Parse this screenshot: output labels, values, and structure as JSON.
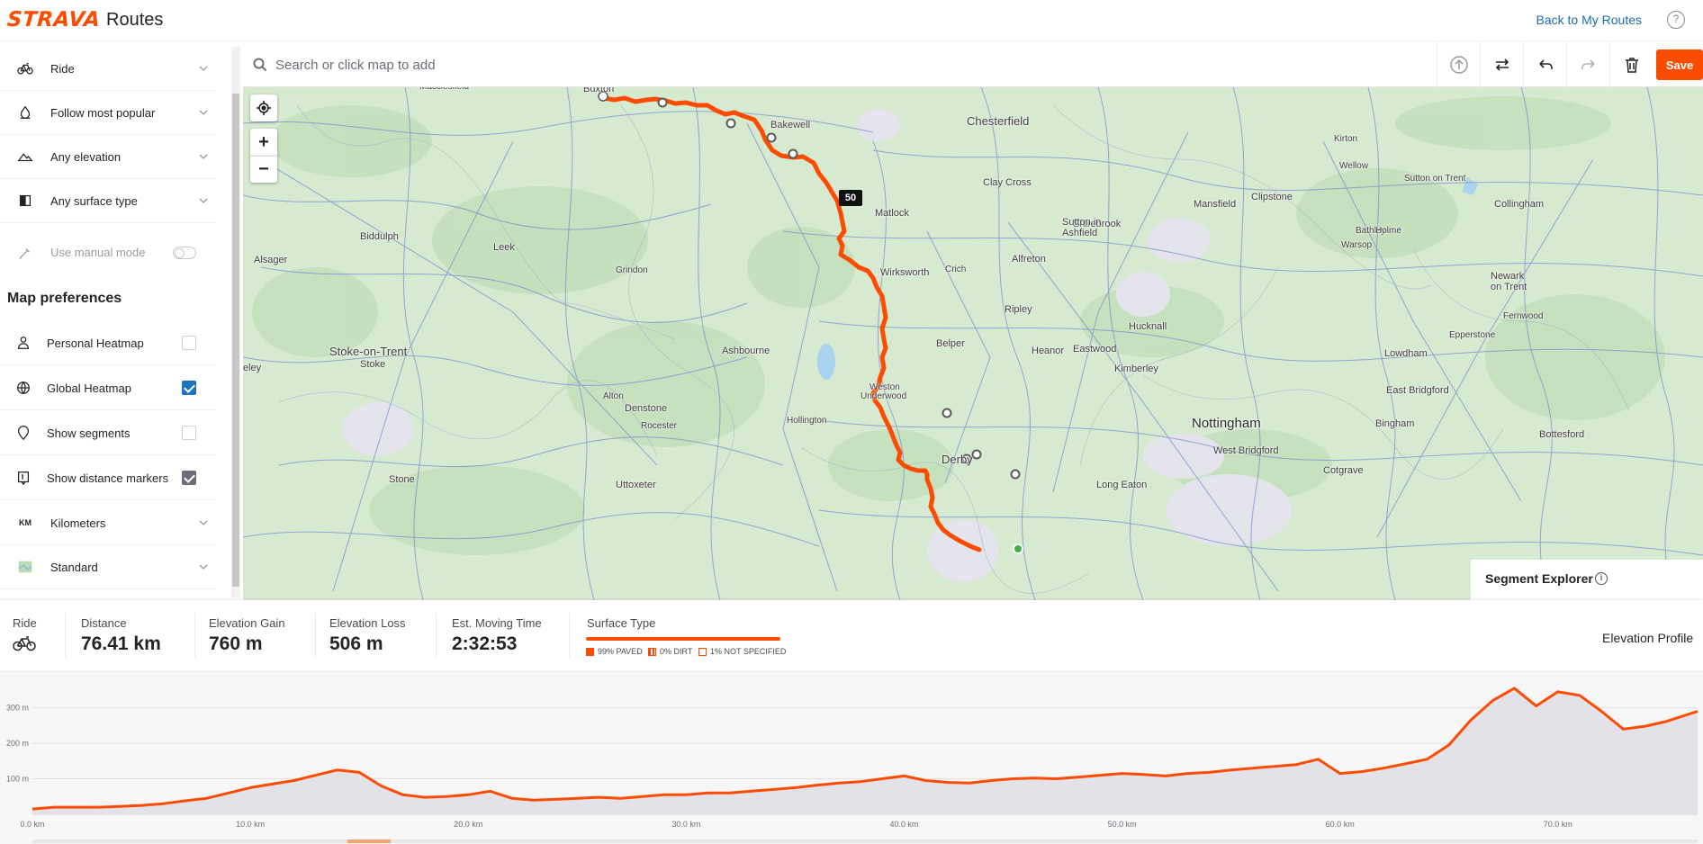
{
  "header": {
    "logo": "STRAVA",
    "title": "Routes",
    "back_link": "Back to My Routes",
    "help": "?"
  },
  "sidebar": {
    "options": [
      {
        "label": "Ride",
        "icon": "bike-icon"
      },
      {
        "label": "Follow most popular",
        "icon": "popularity-icon"
      },
      {
        "label": "Any elevation",
        "icon": "elevation-icon"
      },
      {
        "label": "Any surface type",
        "icon": "surface-icon"
      }
    ],
    "manual_mode": {
      "label": "Use manual mode",
      "enabled": false
    },
    "map_preferences_title": "Map preferences",
    "preferences": [
      {
        "label": "Personal Heatmap",
        "icon": "person-icon",
        "checked": false
      },
      {
        "label": "Global Heatmap",
        "icon": "globe-icon",
        "checked": true
      },
      {
        "label": "Show segments",
        "icon": "segment-icon",
        "checked": false
      },
      {
        "label": "Show distance markers",
        "icon": "distance-marker-icon",
        "checked": true
      }
    ],
    "units": {
      "label": "Kilometers",
      "badge": "KM"
    },
    "map_style": {
      "label": "Standard"
    }
  },
  "search": {
    "placeholder": "Search or click map to add"
  },
  "toolbar": {
    "save_label": "Save"
  },
  "map": {
    "distance_marker": "50",
    "zoom_in": "+",
    "zoom_out": "−",
    "segment_explorer": "Segment Explorer",
    "segment_info": "i",
    "towns": [
      {
        "name": "Chesterfield",
        "cls": "med"
      },
      {
        "name": "Macclesfield",
        "cls": "small"
      },
      {
        "name": "Buxton",
        "cls": ""
      },
      {
        "name": "Bakewell",
        "cls": ""
      },
      {
        "name": "Shirebrook",
        "cls": ""
      },
      {
        "name": "Kirton",
        "cls": "small"
      },
      {
        "name": "Clipstone",
        "cls": ""
      },
      {
        "name": "Sutton on Trent",
        "cls": "small"
      },
      {
        "name": "Collingham",
        "cls": ""
      },
      {
        "name": "Warsop",
        "cls": "small"
      },
      {
        "name": "Wellow",
        "cls": "small"
      },
      {
        "name": "Clay Cross",
        "cls": ""
      },
      {
        "name": "Mansfield",
        "cls": ""
      },
      {
        "name": "Matlock",
        "cls": ""
      },
      {
        "name": "Sutton in",
        "cls": ""
      },
      {
        "name": "Ashfield",
        "cls": ""
      },
      {
        "name": "Bathley",
        "cls": "small"
      },
      {
        "name": "Holme",
        "cls": "small"
      },
      {
        "name": "Biddulph",
        "cls": ""
      },
      {
        "name": "Leek",
        "cls": ""
      },
      {
        "name": "Alfreton",
        "cls": ""
      },
      {
        "name": "Alsager",
        "cls": ""
      },
      {
        "name": "Crich",
        "cls": "small"
      },
      {
        "name": "Grindon",
        "cls": "small"
      },
      {
        "name": "Wirksworth",
        "cls": ""
      },
      {
        "name": "Newark",
        "cls": ""
      },
      {
        "name": "on Trent",
        "cls": ""
      },
      {
        "name": "Ripley",
        "cls": ""
      },
      {
        "name": "Fernwood",
        "cls": "small"
      },
      {
        "name": "Hucknall",
        "cls": ""
      },
      {
        "name": "Epperstone",
        "cls": "small"
      },
      {
        "name": "Belper",
        "cls": ""
      },
      {
        "name": "Stoke-on-Trent",
        "cls": "med"
      },
      {
        "name": "Ashbourne",
        "cls": ""
      },
      {
        "name": "Heanor",
        "cls": ""
      },
      {
        "name": "Eastwood",
        "cls": ""
      },
      {
        "name": "Lowdham",
        "cls": ""
      },
      {
        "name": "Stoke",
        "cls": ""
      },
      {
        "name": "Kimberley",
        "cls": ""
      },
      {
        "name": "eley",
        "cls": ""
      },
      {
        "name": "Weston",
        "cls": "small"
      },
      {
        "name": "Underwood",
        "cls": "small"
      },
      {
        "name": "East Bridgford",
        "cls": ""
      },
      {
        "name": "Alton",
        "cls": "small"
      },
      {
        "name": "Denstone",
        "cls": ""
      },
      {
        "name": "Nottingham",
        "cls": "big"
      },
      {
        "name": "Bingham",
        "cls": ""
      },
      {
        "name": "Hollington",
        "cls": "small"
      },
      {
        "name": "Rocester",
        "cls": "small"
      },
      {
        "name": "West Bridgford",
        "cls": ""
      },
      {
        "name": "Bottesford",
        "cls": ""
      },
      {
        "name": "Derby",
        "cls": "med"
      },
      {
        "name": "Cotgrave",
        "cls": ""
      },
      {
        "name": "Stone",
        "cls": ""
      },
      {
        "name": "Uttoxeter",
        "cls": ""
      },
      {
        "name": "Long Eaton",
        "cls": ""
      }
    ]
  },
  "stats": {
    "activity_label": "Ride",
    "distance": {
      "label": "Distance",
      "value": "76.41 km"
    },
    "elevation_gain": {
      "label": "Elevation Gain",
      "value": "760 m"
    },
    "elevation_loss": {
      "label": "Elevation Loss",
      "value": "506 m"
    },
    "moving_time": {
      "label": "Est. Moving Time",
      "value": "2:32:53"
    },
    "surface": {
      "label": "Surface Type",
      "legend": [
        "99% PAVED",
        "0% DIRT",
        "1% NOT SPECIFIED"
      ]
    },
    "elevation_profile_label": "Elevation Profile"
  },
  "colors": {
    "accent": "#fc4c02",
    "link": "#1c6ca8",
    "check": "#1c74c0"
  },
  "chart_data": {
    "type": "area",
    "x_unit": "km",
    "y_unit": "m",
    "xlim": [
      0,
      76.41
    ],
    "ylim": [
      0,
      380
    ],
    "y_ticks": [
      "100 m",
      "200 m",
      "300 m"
    ],
    "y_tick_values": [
      100,
      200,
      300
    ],
    "x_ticks": [
      "0.0 km",
      "10.0 km",
      "20.0 km",
      "30.0 km",
      "40.0 km",
      "50.0 km",
      "60.0 km",
      "70.0 km"
    ],
    "x_tick_values": [
      0,
      10,
      20,
      30,
      40,
      50,
      60,
      70
    ],
    "x": [
      0,
      1,
      2,
      3,
      4,
      5,
      6,
      7,
      8,
      9,
      10,
      11,
      12,
      13,
      14,
      15,
      16,
      17,
      18,
      19,
      20,
      21,
      22,
      23,
      24,
      25,
      26,
      27,
      28,
      29,
      30,
      31,
      32,
      33,
      34,
      35,
      36,
      37,
      38,
      39,
      40,
      41,
      42,
      43,
      44,
      45,
      46,
      47,
      48,
      49,
      50,
      51,
      52,
      53,
      54,
      55,
      56,
      57,
      58,
      59,
      60,
      61,
      62,
      63,
      64,
      65,
      66,
      67,
      68,
      69,
      70,
      71,
      72,
      73,
      74,
      75,
      76.41
    ],
    "values": [
      15,
      20,
      20,
      20,
      22,
      25,
      30,
      38,
      45,
      60,
      75,
      85,
      95,
      110,
      125,
      118,
      80,
      55,
      48,
      50,
      55,
      65,
      45,
      40,
      42,
      45,
      48,
      45,
      50,
      55,
      55,
      60,
      60,
      65,
      70,
      75,
      82,
      88,
      92,
      100,
      108,
      95,
      90,
      88,
      95,
      100,
      102,
      100,
      105,
      110,
      115,
      112,
      108,
      115,
      118,
      125,
      130,
      135,
      140,
      155,
      115,
      120,
      130,
      142,
      155,
      195,
      265,
      320,
      355,
      305,
      345,
      335,
      290,
      240,
      248,
      262,
      290
    ]
  }
}
